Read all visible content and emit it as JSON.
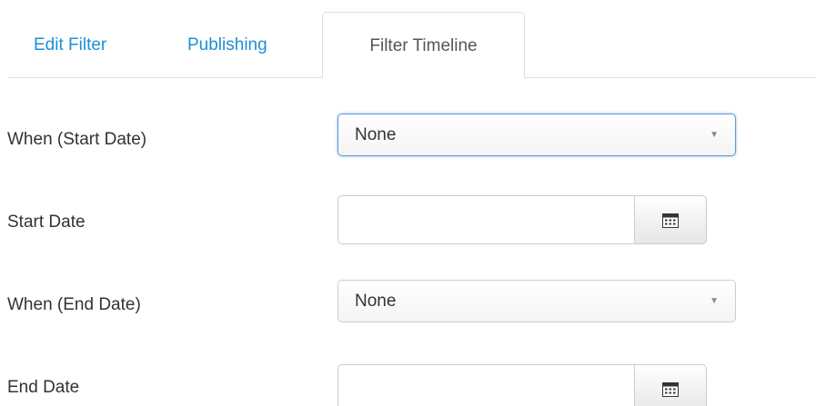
{
  "tabs": [
    {
      "label": "Edit Filter",
      "active": false
    },
    {
      "label": "Publishing",
      "active": false
    },
    {
      "label": "Filter Timeline",
      "active": true
    }
  ],
  "form": {
    "when_start": {
      "label": "When (Start Date)",
      "value": "None"
    },
    "start_date": {
      "label": "Start Date",
      "value": "",
      "icon": "calendar-icon"
    },
    "when_end": {
      "label": "When (End Date)",
      "value": "None"
    },
    "end_date": {
      "label": "End Date",
      "value": "",
      "icon": "calendar-icon"
    }
  },
  "colors": {
    "link": "#1e8fd6",
    "focus_border": "#5c9ad6",
    "border": "#cccccc"
  }
}
